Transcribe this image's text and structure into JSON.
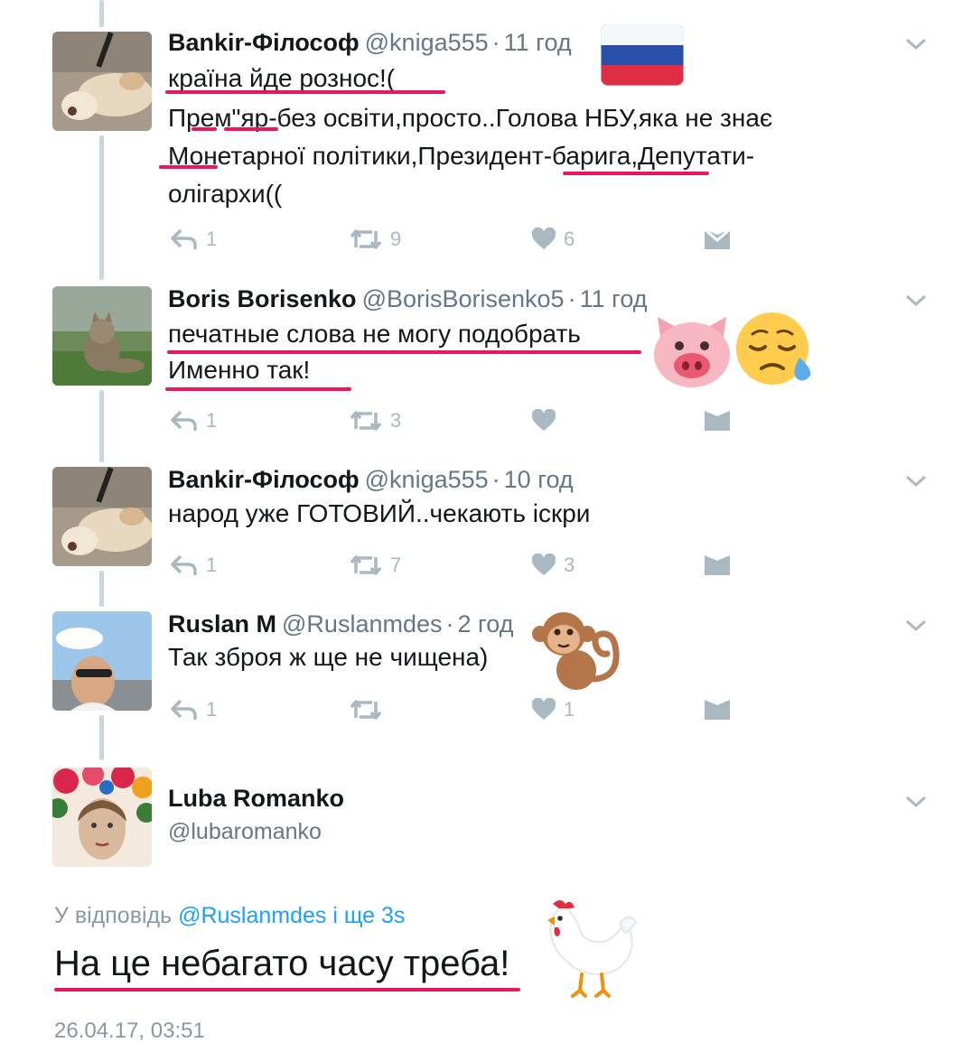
{
  "tweets": [
    {
      "name": "Bankir-Філософ",
      "handle": "@kniga555",
      "time": "11 год",
      "lines": [
        "країна йде рознос!(",
        "Прем\"яр-без освіти,просто..Голова НБУ,яка не знає",
        "Монетарної політики,Президент-барига,Депутати-",
        "олігархи(("
      ],
      "replies": "1",
      "retweets": "9",
      "likes": "6"
    },
    {
      "name": "Boris Borisenko",
      "handle": "@BorisBorisenko5",
      "time": "11 год",
      "lines": [
        "печатные слова не могу подобрать",
        "Именно так!"
      ],
      "replies": "1",
      "retweets": "3",
      "likes": ""
    },
    {
      "name": "Bankir-Філософ",
      "handle": "@kniga555",
      "time": "10 год",
      "lines": [
        "народ уже ГОТОВИЙ..чекають іскри"
      ],
      "replies": "1",
      "retweets": "7",
      "likes": "3"
    },
    {
      "name": "Ruslan M",
      "handle": "@Ruslanmdes",
      "time": "2 год",
      "lines": [
        "Так зброя ж ще не чищена)"
      ],
      "replies": "1",
      "retweets": "",
      "likes": "1"
    }
  ],
  "focused": {
    "name": "Luba Romanko",
    "handle": "@lubaromanko",
    "reply_prefix": "У відповідь",
    "reply_targets": "@Ruslanmdes і ще 3s",
    "text": "На це небагато часу треба!",
    "timestamp": "26.04.17, 03:51"
  },
  "separator": "·",
  "icons": [
    "reply-icon",
    "retweet-icon",
    "like-icon",
    "dm-icon",
    "chevron-down-icon",
    "russia-flag-icon",
    "pig-face-icon",
    "sad-face-icon",
    "monkey-icon",
    "rooster-icon"
  ],
  "colors": {
    "underline": "#e8195a",
    "link": "#1da1f2",
    "meta": "#657786",
    "action": "#aab8c2",
    "thread": "#ccd6dd"
  }
}
